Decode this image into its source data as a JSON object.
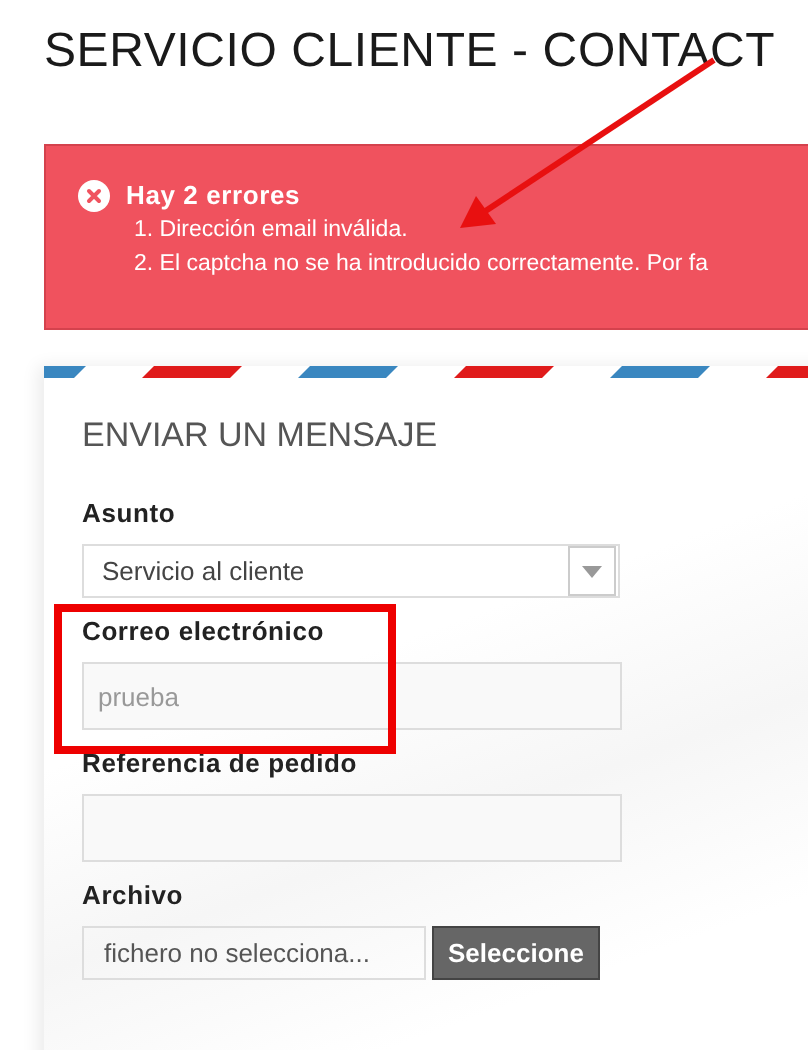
{
  "page_title": "SERVICIO CLIENTE - CONTACT",
  "error": {
    "title": "Hay 2 errores",
    "items": [
      "1. Dirección email inválida.",
      "2. El captcha no se ha introducido correctamente. Por fa"
    ]
  },
  "form": {
    "title": "ENVIAR UN MENSAJE",
    "fields": [
      {
        "kind": "select",
        "label": "Asunto",
        "value": "Servicio al cliente"
      },
      {
        "kind": "text",
        "label": "Correo electrónico",
        "placeholder": "prueba"
      },
      {
        "kind": "text",
        "label": "Referencia de pedido"
      },
      {
        "kind": "file",
        "label": "Archivo",
        "value": "fichero no selecciona...",
        "button": "Seleccione"
      }
    ]
  }
}
